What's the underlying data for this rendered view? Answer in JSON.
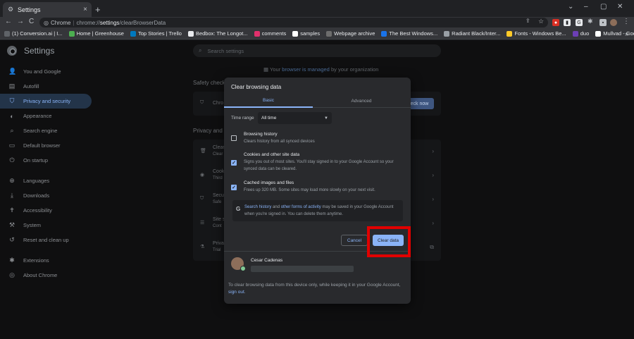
{
  "window": {
    "tab_title": "Settings",
    "tab_close": "×",
    "new_tab": "+",
    "controls": [
      "⌄",
      "–",
      "▢",
      "✕"
    ]
  },
  "toolbar": {
    "back": "←",
    "forward": "→",
    "reload": "C",
    "site": "Chrome",
    "url_scheme": "chrome://",
    "url_main": "settings",
    "url_path": "/clearBrowserData"
  },
  "bookmarks": [
    {
      "label": "(1) Conversion.ai | I...",
      "color": "#5f6368"
    },
    {
      "label": "Home | Greenhouse",
      "color": "#4caf50"
    },
    {
      "label": "Top Stories | Trello",
      "color": "#0079bf"
    },
    {
      "label": "Bedbox: The Longot...",
      "color": "#e8eaed"
    },
    {
      "label": "comments",
      "color": "#e1306c"
    },
    {
      "label": "samples",
      "color": "#ffffff"
    },
    {
      "label": "Webpage archive",
      "color": "#6d6d6d"
    },
    {
      "label": "The Best Windows...",
      "color": "#1a73e8"
    },
    {
      "label": "Radiant Black/Inter...",
      "color": "#9aa0a6"
    },
    {
      "label": "Fonts - Windows Be...",
      "color": "#ffca28"
    },
    {
      "label": "duo",
      "color": "#6c3fb5"
    },
    {
      "label": "Mullvad - Google S...",
      "color": "#ffffff"
    }
  ],
  "bookmarks_more": "»",
  "settings": {
    "title": "Settings",
    "search_placeholder": "Search settings",
    "managed_prefix": "Your",
    "managed_link": "browser is managed",
    "managed_suffix": "by your organization"
  },
  "sidebar": [
    {
      "label": "You and Google",
      "icon": "person-icon",
      "glyph": "👤"
    },
    {
      "label": "Autofill",
      "icon": "clipboard-icon",
      "glyph": "▤"
    },
    {
      "label": "Privacy and security",
      "icon": "shield-icon",
      "glyph": "⛉",
      "active": true
    },
    {
      "label": "Appearance",
      "icon": "palette-icon",
      "glyph": "◐"
    },
    {
      "label": "Search engine",
      "icon": "search-icon",
      "glyph": "⌕"
    },
    {
      "label": "Default browser",
      "icon": "browser-icon",
      "glyph": "▭"
    },
    {
      "label": "On startup",
      "icon": "power-icon",
      "glyph": "⏻"
    },
    {
      "label": "Languages",
      "icon": "globe-icon",
      "glyph": "⊕"
    },
    {
      "label": "Downloads",
      "icon": "download-icon",
      "glyph": "⤓"
    },
    {
      "label": "Accessibility",
      "icon": "accessibility-icon",
      "glyph": "✝"
    },
    {
      "label": "System",
      "icon": "wrench-icon",
      "glyph": "⚒"
    },
    {
      "label": "Reset and clean up",
      "icon": "history-icon",
      "glyph": "↺"
    },
    {
      "label": "Extensions",
      "icon": "puzzle-icon",
      "glyph": "✱"
    },
    {
      "label": "About Chrome",
      "icon": "chrome-icon",
      "glyph": "◎"
    }
  ],
  "background": {
    "safety_check_title": "Safety check",
    "safety_check_row": "Chro",
    "check_now": "eck now",
    "privacy_title": "Privacy and s",
    "rows": [
      {
        "title": "Clear",
        "sub": "Clear"
      },
      {
        "title": "Cook",
        "sub": "Third"
      },
      {
        "title": "Secu",
        "sub": "Safe"
      },
      {
        "title": "Site s",
        "sub": "Cont"
      },
      {
        "title": "Priva",
        "sub": "Trial"
      }
    ]
  },
  "dialog": {
    "title": "Clear browsing data",
    "tabs": [
      "Basic",
      "Advanced"
    ],
    "time_range_label": "Time range",
    "time_range_value": "All time",
    "options": [
      {
        "title": "Browsing history",
        "desc": "Clears history from all synced devices",
        "checked": false
      },
      {
        "title": "Cookies and other site data",
        "desc": "Signs you out of most sites. You'll stay signed in to your Google Account so your synced data can be cleared.",
        "checked": true
      },
      {
        "title": "Cached images and files",
        "desc": "Frees up 320 MB. Some sites may load more slowly on your next visit.",
        "checked": true
      }
    ],
    "google_note": {
      "link1": "Search history",
      "and": " and ",
      "link2": "other forms of activity",
      "rest": " may be saved in your Google Account when you're signed in. You can delete them anytime."
    },
    "cancel": "Cancel",
    "clear": "Clear data",
    "profile_name": "Cesar Cadenas",
    "footer_text": "To clear browsing data from this device only, while keeping it in your Google Account, ",
    "footer_link": "sign out",
    "footer_end": "."
  },
  "highlight_color": "#e10000"
}
